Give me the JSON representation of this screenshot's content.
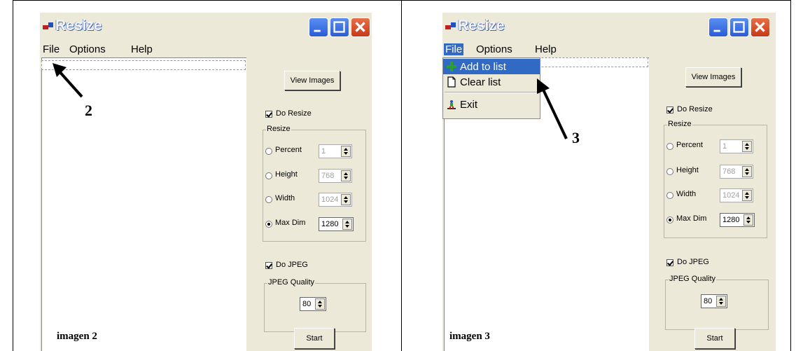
{
  "left": {
    "window": {
      "title": "Resize"
    },
    "menu": [
      "File",
      "Options",
      "Help"
    ],
    "panel": {
      "view_images": "View Images",
      "do_resize": "Do Resize",
      "resize_group": "Resize",
      "percent": {
        "label": "Percent",
        "value": "1"
      },
      "height": {
        "label": "Height",
        "value": "768"
      },
      "width": {
        "label": "Width",
        "value": "1024"
      },
      "maxdim": {
        "label": "Max Dim",
        "value": "1280"
      },
      "do_jpeg": "Do JPEG",
      "jpeg_group": "JPEG Quality",
      "jpeg_quality": "80",
      "start": "Start"
    },
    "annotation_number": "2",
    "caption": "imagen 2"
  },
  "right": {
    "window": {
      "title": "Resize"
    },
    "menu": [
      "File",
      "Options",
      "Help"
    ],
    "file_menu": [
      {
        "label": "Add to list",
        "icon": "plus-icon"
      },
      {
        "label": "Clear list",
        "icon": "document-icon"
      },
      {
        "label": "Exit",
        "icon": "exit-icon"
      }
    ],
    "panel": {
      "view_images": "View Images",
      "do_resize": "Do Resize",
      "resize_group": "Resize",
      "percent": {
        "label": "Percent",
        "value": "1"
      },
      "height": {
        "label": "Height",
        "value": "768"
      },
      "width": {
        "label": "Width",
        "value": "1024"
      },
      "maxdim": {
        "label": "Max Dim",
        "value": "1280"
      },
      "do_jpeg": "Do JPEG",
      "jpeg_group": "JPEG Quality",
      "jpeg_quality": "80",
      "start": "Start"
    },
    "annotation_number": "3",
    "caption": "imagen 3"
  },
  "colors": {
    "menu_highlight": "#316ac5",
    "titlebar_button_blue": "#2a5cd8",
    "close_button_red": "#c83a16"
  }
}
